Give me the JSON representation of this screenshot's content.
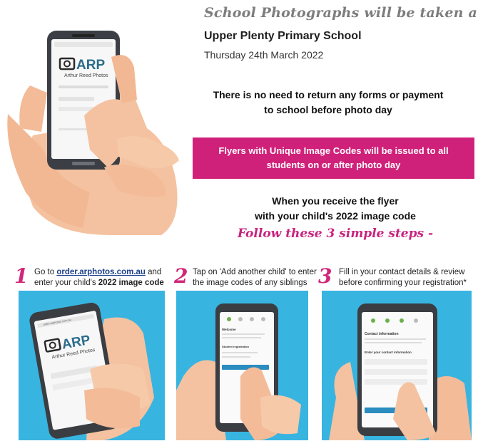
{
  "header": {
    "headline": "School Photographs will be taken at",
    "school": "Upper Plenty Primary School",
    "date": "Thursday 24th March 2022"
  },
  "notice": {
    "line1": "There is no need to return any forms or payment",
    "line2": "to school before photo day"
  },
  "banner": {
    "line1": "Flyers with Unique Image Codes will be issued to all",
    "line2": "students on or after photo day",
    "color": "#d0217a"
  },
  "receive": {
    "line1": "When you receive the flyer",
    "line2": "with your child's 2022 image code"
  },
  "follow": "Follow these 3 simple steps -",
  "brand": {
    "logo": "ARP",
    "tagline": "Arthur Reed Photos"
  },
  "steps": [
    {
      "number": "1",
      "prefix": "Go to ",
      "link": "order.arphotos.com.au",
      "middle": " and enter your child's ",
      "bold": "2022 image code"
    },
    {
      "number": "2",
      "text": "Tap on 'Add another child' to enter the image codes of any siblings"
    },
    {
      "number": "3",
      "text": "Fill in your contact details & review before confirming your registration*"
    }
  ],
  "phone_screens": {
    "url": "order.arphotos.com.au",
    "step2_heading": "Welcome",
    "step2_subheading": "Student registration",
    "step3_heading": "Contact information",
    "step3_subheading": "Enter your contact information"
  },
  "colors": {
    "magenta": "#d0217a",
    "panel_blue": "#38b4e0",
    "skin": "#f2b894",
    "phone": "#3a3d42"
  },
  "icons": [
    "camera-icon",
    "hand-icon",
    "phone-icon"
  ]
}
